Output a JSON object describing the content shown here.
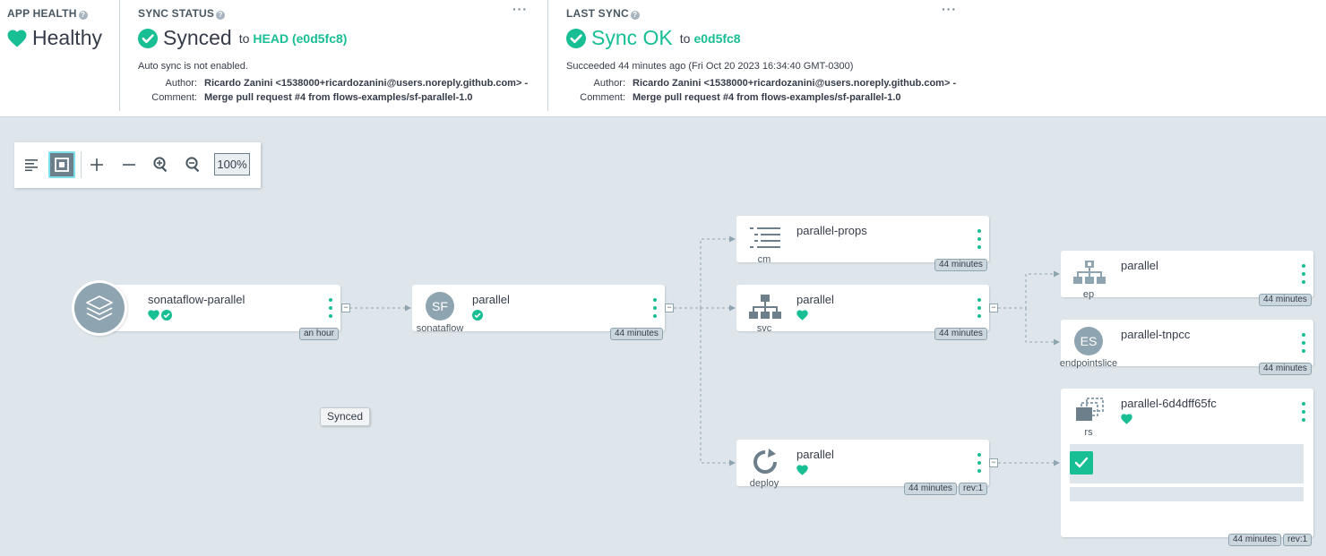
{
  "app_health": {
    "title": "APP HEALTH",
    "status": "Healthy",
    "colors": {
      "healthy": "#18be94"
    }
  },
  "sync_status": {
    "title": "SYNC STATUS",
    "status": "Synced",
    "to_label": "to",
    "revision": "HEAD (e0d5fc8)",
    "auto_sync": "Auto sync is not enabled.",
    "author_label": "Author:",
    "author": "Ricardo Zanini <1538000+ricardozanini@users.noreply.github.com> -",
    "comment_label": "Comment:",
    "comment": "Merge pull request #4 from flows-examples/sf-parallel-1.0"
  },
  "last_sync": {
    "title": "LAST SYNC",
    "status": "Sync OK",
    "to_label": "to",
    "revision": "e0d5fc8",
    "succeeded": "Succeeded 44 minutes ago (Fri Oct 20 2023 16:34:40 GMT-0300)",
    "author_label": "Author:",
    "author": "Ricardo Zanini <1538000+ricardozanini@users.noreply.github.com> -",
    "comment_label": "Comment:",
    "comment": "Merge pull request #4 from flows-examples/sf-parallel-1.0"
  },
  "toolbar": {
    "zoom": "100%",
    "icons": [
      "list-view-icon",
      "fit-to-screen-icon",
      "expand-icon",
      "collapse-icon",
      "zoom-in-icon",
      "zoom-out-icon"
    ]
  },
  "nodes": {
    "app": {
      "name": "sonataflow-parallel",
      "age": "an hour"
    },
    "sonataflow": {
      "name": "parallel",
      "kind": "sonataflow",
      "badge": "SF",
      "age": "44 minutes"
    },
    "cm": {
      "name": "parallel-props",
      "kind": "cm",
      "age": "44 minutes"
    },
    "svc": {
      "name": "parallel",
      "kind": "svc",
      "age": "44 minutes"
    },
    "deploy": {
      "name": "parallel",
      "kind": "deploy",
      "age": "44 minutes",
      "rev": "rev:1"
    },
    "ep": {
      "name": "parallel",
      "kind": "ep",
      "age": "44 minutes"
    },
    "endpointslice": {
      "name": "parallel-tnpcc",
      "kind": "endpointslice",
      "badge": "ES",
      "age": "44 minutes"
    },
    "rs": {
      "name": "parallel-6d4dff65fc",
      "kind": "rs",
      "age": "44 minutes",
      "rev": "rev:1"
    }
  },
  "tooltip": "Synced"
}
